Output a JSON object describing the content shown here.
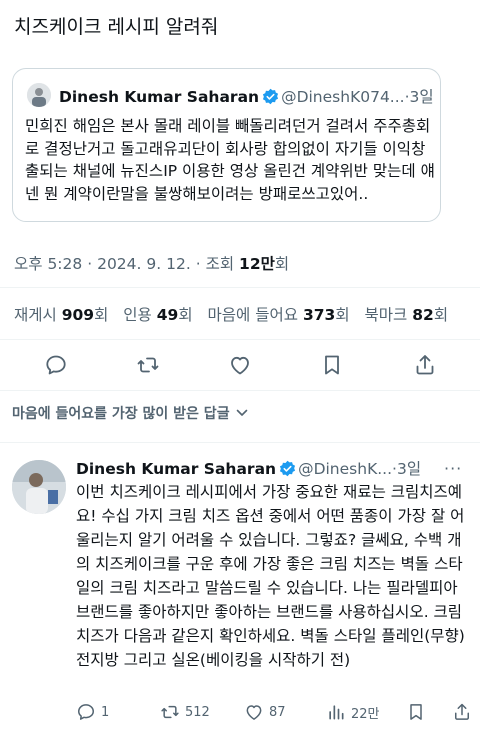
{
  "page_title": "치즈케이크 레시피 알려줘",
  "quoted_post": {
    "author_name": "Dinesh Kumar Saharan",
    "handle": "@DineshK074...",
    "separator": "·",
    "time": "3일",
    "text": "민희진 해임은 본사 몰래 레이블 빼돌리려던거 걸려서 주주총회로 결정난거고 돌고래유괴단이 회사랑 합의없이 자기들 이익창출되는 채널에 뉴진스IP 이용한 영상 올린건 계약위반 맞는데 얘넨 뭔 계약이란말을 불쌍해보이려는 방패로쓰고있어.."
  },
  "post_meta": {
    "time": "오후 5:28",
    "dot": "·",
    "date": "2024. 9. 12.",
    "views_label": "조회",
    "views_value": "12만",
    "views_unit": "회"
  },
  "stats": {
    "reposts_label": "재게시",
    "reposts_value": "909",
    "reposts_unit": "회",
    "quotes_label": "인용",
    "quotes_value": "49",
    "quotes_unit": "회",
    "likes_label": "마음에 들어요",
    "likes_value": "373",
    "likes_unit": "회",
    "bookmarks_label": "북마크",
    "bookmarks_value": "82",
    "bookmarks_unit": "회"
  },
  "actions": [
    "reply-icon",
    "retweet-icon",
    "heart-icon",
    "bookmark-icon",
    "share-icon"
  ],
  "sort": {
    "label": "마음에 들어요를 가장 많이 받은 답글"
  },
  "reply": {
    "author_name": "Dinesh Kumar Saharan",
    "handle": "@DineshK...",
    "separator": "·",
    "time": "3일",
    "more": "···",
    "text": "이번 치즈케이크 레시피에서 가장 중요한 재료는 크림치즈예요! 수십 가지 크림 치즈 옵션 중에서 어떤 품종이 가장 잘 어울리는지 알기 어려울 수 있습니다. 그렇죠? 글쎄요, 수백 개의 치즈케이크를 구운 후에 가장 좋은 크림 치즈는 벽돌 스타일의 크림 치즈라고 말씀드릴 수 있습니다. 나는 필라델피아 브랜드를 좋아하지만 좋아하는 브랜드를 사용하십시오. 크림 치즈가 다음과 같은지 확인하세요. 벽돌 스타일 플레인(무향) 전지방 그리고 실온(베이킹을 시작하기 전)",
    "replies": "1",
    "retweets": "512",
    "likes": "87",
    "views": "22만"
  },
  "colors": {
    "text": "#0f1419",
    "secondary": "#536471",
    "verified": "#1d9bf0",
    "border": "#cfd9de"
  }
}
